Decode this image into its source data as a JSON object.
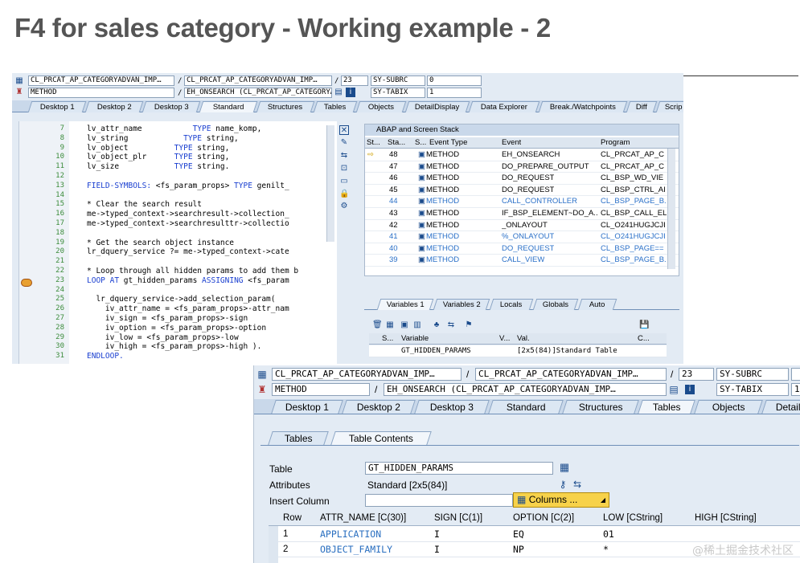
{
  "slide": {
    "title": "F4 for sales category - Working example - 2"
  },
  "win1": {
    "header": {
      "field1": "CL_PRCAT_AP_CATEGORYADVAN_IMP…",
      "field2": "CL_PRCAT_AP_CATEGORYADVAN_IMP…",
      "line": "23",
      "subrc_label": "SY-SUBRC",
      "subrc_value": "0",
      "event_type": "METHOD",
      "event": "EH_ONSEARCH (CL_PRCAT_AP_CATEGORYADVAN_IMP…",
      "tabix_label": "SY-TABIX",
      "tabix_value": "1",
      "sep": "/"
    },
    "tabs": [
      "Desktop 1",
      "Desktop 2",
      "Desktop 3",
      "Standard",
      "Structures",
      "Tables",
      "Objects",
      "DetailDisplay",
      "Data Explorer",
      "Break./Watchpoints",
      "Diff",
      "Scrip"
    ],
    "code": [
      {
        "n": "7",
        "t": "lv_attr_name           TYPE name_komp,"
      },
      {
        "n": "8",
        "t": "lv_string            TYPE string,"
      },
      {
        "n": "9",
        "t": "lv_object          TYPE string,"
      },
      {
        "n": "10",
        "t": "lv_object_plr      TYPE string,"
      },
      {
        "n": "11",
        "t": "lv_size            TYPE string."
      },
      {
        "n": "12",
        "t": ""
      },
      {
        "n": "13",
        "t": "FIELD-SYMBOLS: <fs_param_props> TYPE genilt_"
      },
      {
        "n": "14",
        "t": ""
      },
      {
        "n": "15",
        "t": "* Clear the search result"
      },
      {
        "n": "16",
        "t": "me->typed_context->searchresult->collection_"
      },
      {
        "n": "17",
        "t": "me->typed_context->searchresulttr->collectio"
      },
      {
        "n": "18",
        "t": ""
      },
      {
        "n": "19",
        "t": "* Get the search object instance"
      },
      {
        "n": "20",
        "t": "lr_dquery_service ?= me->typed_context->cate"
      },
      {
        "n": "21",
        "t": ""
      },
      {
        "n": "22",
        "t": "* Loop through all hidden params to add them b"
      },
      {
        "n": "23",
        "t": "LOOP AT gt_hidden_params ASSIGNING <fs_param"
      },
      {
        "n": "24",
        "t": ""
      },
      {
        "n": "25",
        "t": "  lr_dquery_service->add_selection_param("
      },
      {
        "n": "26",
        "t": "    iv_attr_name = <fs_param_props>-attr_nam"
      },
      {
        "n": "27",
        "t": "    iv_sign = <fs_param_props>-sign"
      },
      {
        "n": "28",
        "t": "    iv_option = <fs_param_props>-option"
      },
      {
        "n": "29",
        "t": "    iv_low = <fs_param_props>-low"
      },
      {
        "n": "30",
        "t": "    iv_high = <fs_param_props>-high )."
      },
      {
        "n": "31",
        "t": "ENDLOOP."
      }
    ],
    "stack": {
      "title": "ABAP and Screen Stack",
      "headers": [
        "St...",
        "Sta...",
        "S...",
        "Event Type",
        "Event",
        "Program"
      ],
      "rows": [
        {
          "sta": "48",
          "type": "METHOD",
          "event": "EH_ONSEARCH",
          "prog": "CL_PRCAT_AP_C",
          "link": false
        },
        {
          "sta": "47",
          "type": "METHOD",
          "event": "DO_PREPARE_OUTPUT",
          "prog": "CL_PRCAT_AP_C",
          "link": false
        },
        {
          "sta": "46",
          "type": "METHOD",
          "event": "DO_REQUEST",
          "prog": "CL_BSP_WD_VIE",
          "link": false
        },
        {
          "sta": "45",
          "type": "METHOD",
          "event": "DO_REQUEST",
          "prog": "CL_BSP_CTRL_AI",
          "link": false
        },
        {
          "sta": "44",
          "type": "METHOD",
          "event": "CALL_CONTROLLER",
          "prog": "CL_BSP_PAGE_B.",
          "link": true
        },
        {
          "sta": "43",
          "type": "METHOD",
          "event": "IF_BSP_ELEMENT~DO_A..",
          "prog": "CL_BSP_CALL_EL",
          "link": false
        },
        {
          "sta": "42",
          "type": "METHOD",
          "event": "_ONLAYOUT",
          "prog": "CL_O241HUGJCJI",
          "link": false
        },
        {
          "sta": "41",
          "type": "METHOD",
          "event": "%_ONLAYOUT",
          "prog": "CL_O241HUGJCJI",
          "link": true
        },
        {
          "sta": "40",
          "type": "METHOD",
          "event": "DO_REQUEST",
          "prog": "CL_BSP_PAGE==",
          "link": true
        },
        {
          "sta": "39",
          "type": "METHOD",
          "event": "CALL_VIEW",
          "prog": "CL_BSP_PAGE_B.",
          "link": true
        }
      ]
    },
    "vars": {
      "tabs": [
        "Variables 1",
        "Variables 2",
        "Locals",
        "Globals",
        "Auto"
      ],
      "headers": [
        "S...",
        "Variable",
        "V...",
        "Val.",
        "C..."
      ],
      "row": {
        "variable": "GT_HIDDEN_PARAMS",
        "value": "[2x5(84)]Standard Table"
      }
    }
  },
  "win2": {
    "header": {
      "field1": "CL_PRCAT_AP_CATEGORYADVAN_IMP…",
      "field2": "CL_PRCAT_AP_CATEGORYADVAN_IMP…",
      "line": "23",
      "subrc_label": "SY-SUBRC",
      "event_type": "METHOD",
      "event": "EH_ONSEARCH (CL_PRCAT_AP_CATEGORYADVAN_IMP…",
      "tabix_label": "SY-TABIX",
      "sep": "/",
      "num1": "1"
    },
    "tabs": [
      "Desktop 1",
      "Desktop 2",
      "Desktop 3",
      "Standard",
      "Structures",
      "Tables",
      "Objects",
      "Detail"
    ],
    "subtabs": [
      "Tables",
      "Table Contents"
    ],
    "form": {
      "table_label": "Table",
      "table_value": "GT_HIDDEN_PARAMS",
      "attributes_label": "Attributes",
      "attributes_value": "Standard [2x5(84)]",
      "insert_label": "Insert Column",
      "insert_value": "",
      "columns_button": "Columns ..."
    },
    "table": {
      "headers": [
        "Row",
        "ATTR_NAME [C(30)]",
        "SIGN [C(1)]",
        "OPTION [C(2)]",
        "LOW [CString]",
        "HIGH [CString]"
      ],
      "rows": [
        {
          "row": "1",
          "attr": "APPLICATION",
          "sign": "I",
          "option": "EQ",
          "low": "01",
          "high": ""
        },
        {
          "row": "2",
          "attr": "OBJECT_FAMILY",
          "sign": "I",
          "option": "NP",
          "low": "*",
          "high": ""
        }
      ]
    },
    "watermark": "@稀土掘金技术社区"
  }
}
